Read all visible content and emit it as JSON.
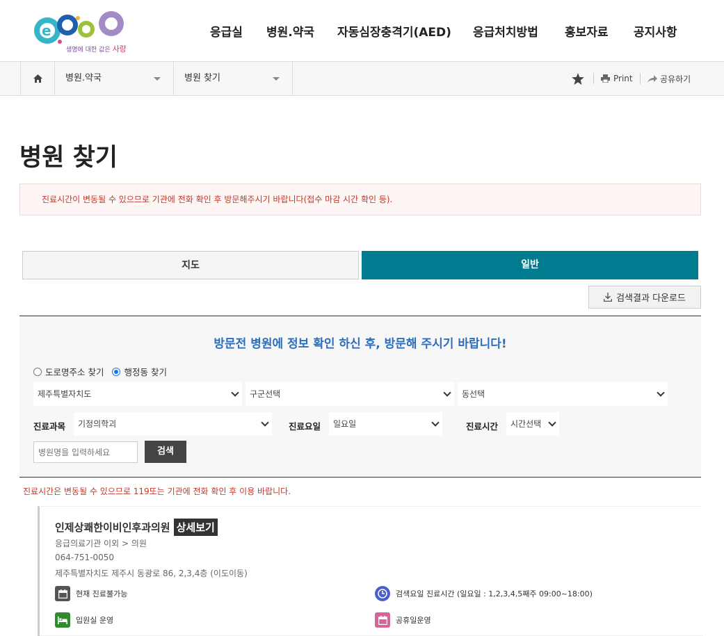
{
  "logo": {
    "tagline_main": "생명에 대한 값은",
    "tagline_accent": "사랑"
  },
  "gnb": [
    "응급실",
    "병원.약국",
    "자동심장충격기(AED)",
    "응급처치방법",
    "홍보자료",
    "공지사항"
  ],
  "location": {
    "depth1": "병원.약국",
    "depth2": "병원 찾기",
    "print_label": "Print",
    "share_label": "공유하기"
  },
  "page_title": "병원 찾기",
  "notice": "진료시간이 변동될 수 있으므로 기관에 전화 확인 후 방문해주시기 바랍니다(접수 마감 시간 확인 등).",
  "tabs": {
    "map": "지도",
    "general": "일반"
  },
  "download_label": "검색결과 다운로드",
  "search": {
    "title": "방문전 병원에 정보 확인 하신 후, 방문해 주시기 바랍니다!",
    "radio_road": "도로명주소 찾기",
    "radio_admin": "행정동 찾기",
    "sido": "제주특별자치도",
    "gugun": "구군선택",
    "dong": "동선택",
    "dept_label": "진료과목",
    "dept_value": "기정의학괴",
    "day_label": "진료요일",
    "day_value": "일요일",
    "time_label": "진료시간",
    "time_value": "시간선택",
    "name_placeholder": "병원명을 입력하세요",
    "button": "검색"
  },
  "red_notice": "진료시간은 변동될 수 있으므로 119또는 기관에 전화 확인 후 이용 바랍니다.",
  "result": {
    "name": "인제상쾌한이비인후과의원",
    "detail_label": "상세보기",
    "category": "응급의료기관 이외 > 의원",
    "phone": "064-751-0050",
    "address": "제주특별자치도 제주시 동광로 86, 2,3,4층 (이도이동)",
    "status_now": "현재 진료불가능",
    "status_hours": "검색요일 진료시간 (일요일 : 1,2,3,4,5째주 09:00~18:00)",
    "status_ward": "입원실 운영",
    "status_holiday": "공휴일운영"
  },
  "colors": {
    "accent": "#007b8f",
    "title_blue": "#2a6ebd",
    "notice_red": "#c0392b"
  }
}
